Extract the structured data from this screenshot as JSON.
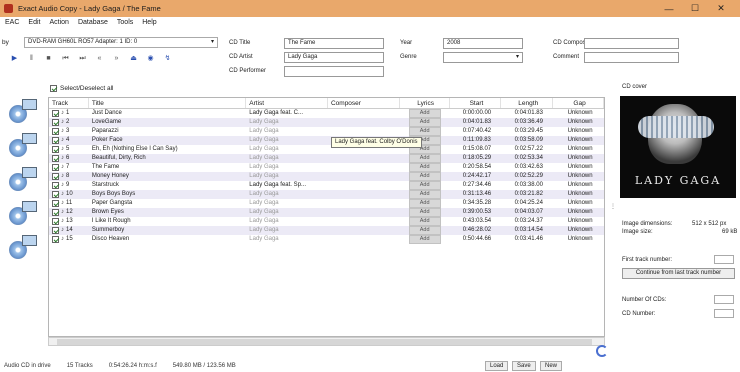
{
  "window": {
    "title": "Exact Audio Copy  -  Lady Gaga / The Fame",
    "minimize": "—",
    "maximize": "☐",
    "close": "✕"
  },
  "menu": [
    "EAC",
    "Edit",
    "Action",
    "Database",
    "Tools",
    "Help"
  ],
  "drive": {
    "label": "by",
    "value": "DVD-RAM GH60L  RO57  Adapter: 1  ID: 0"
  },
  "toolbar_icons": [
    "play-icon",
    "pause-icon",
    "stop-icon",
    "prev-icon",
    "next-icon",
    "rewind-icon",
    "forward-icon",
    "eject-icon",
    "globe-icon",
    "cd-info-icon"
  ],
  "cd_fields": {
    "title_label": "CD Title",
    "title_value": "The Fame",
    "artist_label": "CD Artist",
    "artist_value": "Lady Gaga",
    "performer_label": "CD Performer",
    "performer_value": "",
    "year_label": "Year",
    "year_value": "2008",
    "genre_label": "Genre",
    "genre_value": "",
    "composer_label": "CD Composer",
    "composer_value": "",
    "comment_label": "Comment",
    "comment_value": ""
  },
  "select_all_label": "Select/Deselect all",
  "table": {
    "headers": {
      "track": "Track",
      "title": "Title",
      "artist": "Artist",
      "composer": "Composer",
      "lyrics": "Lyrics",
      "start": "Start",
      "length": "Length",
      "gap": "Gap"
    },
    "add_label": "Add",
    "rows": [
      {
        "n": "1",
        "title": "Just Dance",
        "artist": "Lady Gaga feat. C...",
        "start": "0:00:00.00",
        "length": "0:04:01.83",
        "gap": "Unknown"
      },
      {
        "n": "2",
        "title": "LoveGame",
        "artist": "Lady Gaga",
        "start": "0:04:01.83",
        "length": "0:03:36.49",
        "gap": "Unknown"
      },
      {
        "n": "3",
        "title": "Paparazzi",
        "artist": "Lady Gaga",
        "start": "0:07:40.42",
        "length": "0:03:29.45",
        "gap": "Unknown"
      },
      {
        "n": "4",
        "title": "Poker Face",
        "artist": "Lady Gaga",
        "start": "0:11:09.83",
        "length": "0:03:58.09",
        "gap": "Unknown"
      },
      {
        "n": "5",
        "title": "Eh, Eh (Nothing Else I Can Say)",
        "artist": "Lady Gaga",
        "start": "0:15:08.07",
        "length": "0:02:57.22",
        "gap": "Unknown"
      },
      {
        "n": "6",
        "title": "Beautiful, Dirty, Rich",
        "artist": "Lady Gaga",
        "start": "0:18:05.29",
        "length": "0:02:53.34",
        "gap": "Unknown"
      },
      {
        "n": "7",
        "title": "The Fame",
        "artist": "Lady Gaga",
        "start": "0:20:58.54",
        "length": "0:03:42.63",
        "gap": "Unknown"
      },
      {
        "n": "8",
        "title": "Money Honey",
        "artist": "Lady Gaga",
        "start": "0:24:42.17",
        "length": "0:02:52.29",
        "gap": "Unknown"
      },
      {
        "n": "9",
        "title": "Starstruck",
        "artist": "Lady Gaga feat. Sp...",
        "start": "0:27:34.46",
        "length": "0:03:38.00",
        "gap": "Unknown"
      },
      {
        "n": "10",
        "title": "Boys Boys Boys",
        "artist": "Lady Gaga",
        "start": "0:31:13.46",
        "length": "0:03:21.82",
        "gap": "Unknown"
      },
      {
        "n": "11",
        "title": "Paper Gangsta",
        "artist": "Lady Gaga",
        "start": "0:34:35.28",
        "length": "0:04:25.24",
        "gap": "Unknown"
      },
      {
        "n": "12",
        "title": "Brown Eyes",
        "artist": "Lady Gaga",
        "start": "0:39:00.53",
        "length": "0:04:03.07",
        "gap": "Unknown"
      },
      {
        "n": "13",
        "title": "I Like It Rough",
        "artist": "Lady Gaga",
        "start": "0:43:03.54",
        "length": "0:03:24.37",
        "gap": "Unknown"
      },
      {
        "n": "14",
        "title": "Summerboy",
        "artist": "Lady Gaga",
        "start": "0:46:28.02",
        "length": "0:03:14.54",
        "gap": "Unknown"
      },
      {
        "n": "15",
        "title": "Disco Heaven",
        "artist": "Lady Gaga",
        "start": "0:50:44.66",
        "length": "0:03:41.46",
        "gap": "Unknown"
      }
    ]
  },
  "tooltip": "Lady Gaga feat. Colby O'Donis",
  "statusbar": {
    "s1": "Audio CD in drive",
    "s2": "15 Tracks",
    "s3": "0:54:26.24 h:m:s.f",
    "s4": "549.80 MB / 123.56 MB",
    "load": "Load",
    "save": "Save",
    "new": "New"
  },
  "right_panel": {
    "cover_label": "CD cover",
    "cover_band": "LADY GAGA",
    "dimensions_label": "Image dimensions:",
    "dimensions_value": "512 x 512 px",
    "size_label": "Image size:",
    "size_value": "69 kB",
    "first_track_label": "First track number:",
    "continue_label": "Continue from last track number",
    "num_cds_label": "Number Of CDs:",
    "cd_number_label": "CD Number:"
  }
}
